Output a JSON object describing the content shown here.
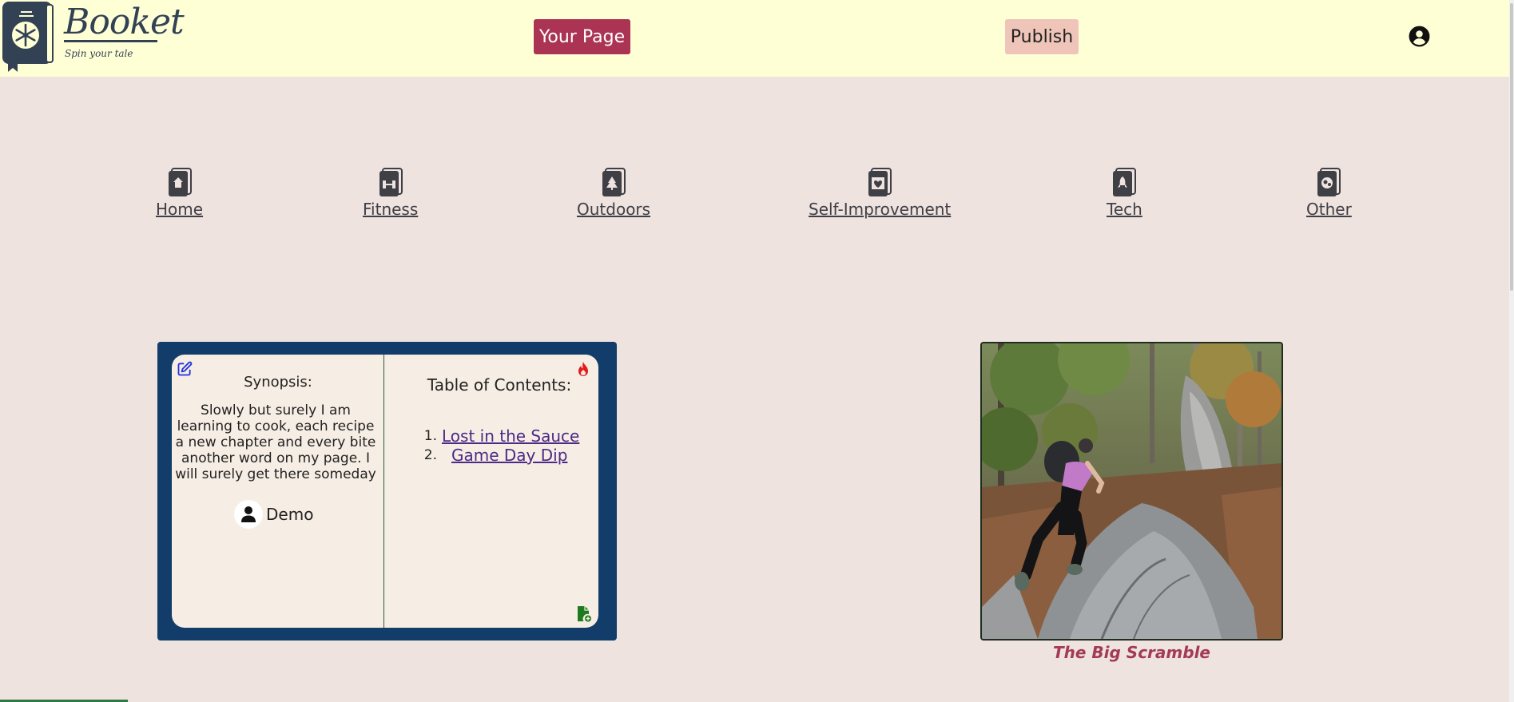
{
  "header": {
    "logo_title": "Booket",
    "logo_subtitle": "Spin your tale",
    "your_page_label": "Your Page",
    "publish_label": "Publish",
    "colors": {
      "background": "#ffffd6",
      "your_page_bg": "#ab3354",
      "publish_bg": "#eec5b8"
    }
  },
  "categories": [
    {
      "label": "Home",
      "icon": "home-book-icon"
    },
    {
      "label": "Fitness",
      "icon": "fitness-book-icon"
    },
    {
      "label": "Outdoors",
      "icon": "outdoors-book-icon"
    },
    {
      "label": "Self-Improvement",
      "icon": "self-improvement-book-icon"
    },
    {
      "label": "Tech",
      "icon": "tech-book-icon"
    },
    {
      "label": "Other",
      "icon": "other-book-icon"
    }
  ],
  "book": {
    "synopsis_label": "Synopsis:",
    "synopsis_text": "Slowly but surely I am learning to cook, each recipe a new chapter and every bite another word on my page. I will surely get there someday",
    "author": "Demo",
    "toc_title": "Table of Contents:",
    "chapters": [
      {
        "num": "1.",
        "title": "Lost in the Sauce"
      },
      {
        "num": "2.",
        "title": "Game Day Dip"
      }
    ],
    "colors": {
      "cover": "#123c69",
      "page": "#f6ede4",
      "link": "#4c2a85"
    }
  },
  "photo": {
    "caption": "The Big Scramble"
  },
  "page": {
    "background": "#eee3df"
  }
}
